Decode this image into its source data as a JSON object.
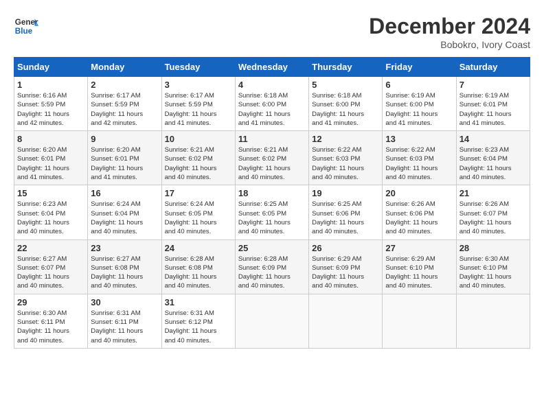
{
  "header": {
    "logo_line1": "General",
    "logo_line2": "Blue",
    "month": "December 2024",
    "location": "Bobokro, Ivory Coast"
  },
  "weekdays": [
    "Sunday",
    "Monday",
    "Tuesday",
    "Wednesday",
    "Thursday",
    "Friday",
    "Saturday"
  ],
  "weeks": [
    [
      {
        "day": "1",
        "info": "Sunrise: 6:16 AM\nSunset: 5:59 PM\nDaylight: 11 hours\nand 42 minutes."
      },
      {
        "day": "2",
        "info": "Sunrise: 6:17 AM\nSunset: 5:59 PM\nDaylight: 11 hours\nand 42 minutes."
      },
      {
        "day": "3",
        "info": "Sunrise: 6:17 AM\nSunset: 5:59 PM\nDaylight: 11 hours\nand 41 minutes."
      },
      {
        "day": "4",
        "info": "Sunrise: 6:18 AM\nSunset: 6:00 PM\nDaylight: 11 hours\nand 41 minutes."
      },
      {
        "day": "5",
        "info": "Sunrise: 6:18 AM\nSunset: 6:00 PM\nDaylight: 11 hours\nand 41 minutes."
      },
      {
        "day": "6",
        "info": "Sunrise: 6:19 AM\nSunset: 6:00 PM\nDaylight: 11 hours\nand 41 minutes."
      },
      {
        "day": "7",
        "info": "Sunrise: 6:19 AM\nSunset: 6:01 PM\nDaylight: 11 hours\nand 41 minutes."
      }
    ],
    [
      {
        "day": "8",
        "info": "Sunrise: 6:20 AM\nSunset: 6:01 PM\nDaylight: 11 hours\nand 41 minutes."
      },
      {
        "day": "9",
        "info": "Sunrise: 6:20 AM\nSunset: 6:01 PM\nDaylight: 11 hours\nand 41 minutes."
      },
      {
        "day": "10",
        "info": "Sunrise: 6:21 AM\nSunset: 6:02 PM\nDaylight: 11 hours\nand 40 minutes."
      },
      {
        "day": "11",
        "info": "Sunrise: 6:21 AM\nSunset: 6:02 PM\nDaylight: 11 hours\nand 40 minutes."
      },
      {
        "day": "12",
        "info": "Sunrise: 6:22 AM\nSunset: 6:03 PM\nDaylight: 11 hours\nand 40 minutes."
      },
      {
        "day": "13",
        "info": "Sunrise: 6:22 AM\nSunset: 6:03 PM\nDaylight: 11 hours\nand 40 minutes."
      },
      {
        "day": "14",
        "info": "Sunrise: 6:23 AM\nSunset: 6:04 PM\nDaylight: 11 hours\nand 40 minutes."
      }
    ],
    [
      {
        "day": "15",
        "info": "Sunrise: 6:23 AM\nSunset: 6:04 PM\nDaylight: 11 hours\nand 40 minutes."
      },
      {
        "day": "16",
        "info": "Sunrise: 6:24 AM\nSunset: 6:04 PM\nDaylight: 11 hours\nand 40 minutes."
      },
      {
        "day": "17",
        "info": "Sunrise: 6:24 AM\nSunset: 6:05 PM\nDaylight: 11 hours\nand 40 minutes."
      },
      {
        "day": "18",
        "info": "Sunrise: 6:25 AM\nSunset: 6:05 PM\nDaylight: 11 hours\nand 40 minutes."
      },
      {
        "day": "19",
        "info": "Sunrise: 6:25 AM\nSunset: 6:06 PM\nDaylight: 11 hours\nand 40 minutes."
      },
      {
        "day": "20",
        "info": "Sunrise: 6:26 AM\nSunset: 6:06 PM\nDaylight: 11 hours\nand 40 minutes."
      },
      {
        "day": "21",
        "info": "Sunrise: 6:26 AM\nSunset: 6:07 PM\nDaylight: 11 hours\nand 40 minutes."
      }
    ],
    [
      {
        "day": "22",
        "info": "Sunrise: 6:27 AM\nSunset: 6:07 PM\nDaylight: 11 hours\nand 40 minutes."
      },
      {
        "day": "23",
        "info": "Sunrise: 6:27 AM\nSunset: 6:08 PM\nDaylight: 11 hours\nand 40 minutes."
      },
      {
        "day": "24",
        "info": "Sunrise: 6:28 AM\nSunset: 6:08 PM\nDaylight: 11 hours\nand 40 minutes."
      },
      {
        "day": "25",
        "info": "Sunrise: 6:28 AM\nSunset: 6:09 PM\nDaylight: 11 hours\nand 40 minutes."
      },
      {
        "day": "26",
        "info": "Sunrise: 6:29 AM\nSunset: 6:09 PM\nDaylight: 11 hours\nand 40 minutes."
      },
      {
        "day": "27",
        "info": "Sunrise: 6:29 AM\nSunset: 6:10 PM\nDaylight: 11 hours\nand 40 minutes."
      },
      {
        "day": "28",
        "info": "Sunrise: 6:30 AM\nSunset: 6:10 PM\nDaylight: 11 hours\nand 40 minutes."
      }
    ],
    [
      {
        "day": "29",
        "info": "Sunrise: 6:30 AM\nSunset: 6:11 PM\nDaylight: 11 hours\nand 40 minutes."
      },
      {
        "day": "30",
        "info": "Sunrise: 6:31 AM\nSunset: 6:11 PM\nDaylight: 11 hours\nand 40 minutes."
      },
      {
        "day": "31",
        "info": "Sunrise: 6:31 AM\nSunset: 6:12 PM\nDaylight: 11 hours\nand 40 minutes."
      },
      {
        "day": "",
        "info": ""
      },
      {
        "day": "",
        "info": ""
      },
      {
        "day": "",
        "info": ""
      },
      {
        "day": "",
        "info": ""
      }
    ]
  ]
}
